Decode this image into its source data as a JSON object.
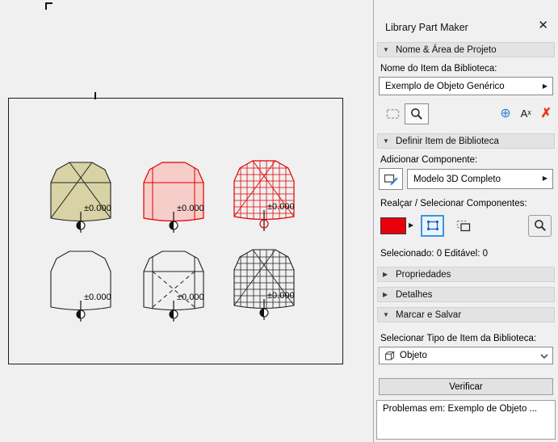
{
  "panel": {
    "title": "Library Part Maker",
    "sections": [
      {
        "label": "Nome & Área de Projeto",
        "arrow": "▼"
      },
      {
        "label": "Definir Item de Biblioteca",
        "arrow": "▼"
      },
      {
        "label": "Propriedades",
        "arrow": "▶"
      },
      {
        "label": "Detalhes",
        "arrow": "▶"
      },
      {
        "label": "Marcar e Salvar",
        "arrow": "▼"
      }
    ],
    "nome_item_label": "Nome do Item da Biblioteca:",
    "nome_item_value": "Exemplo de Objeto Genérico",
    "adicionar_label": "Adicionar Componente:",
    "componente_value": "Modelo 3D Completo",
    "realcar_label": "Realçar / Selecionar Componentes:",
    "selecionado_status": "Selecionado: 0 Editável: 0",
    "tipo_label": "Selecionar Tipo de Item da Biblioteca:",
    "tipo_value": "Objeto",
    "verificar_label": "Verificar",
    "problemas_text": "Problemas em: Exemplo de Objeto ...",
    "colors": {
      "swatch_red": "#e8000d",
      "add_blue": "#2a7fd4",
      "delete_red": "#e8341c",
      "selected_border_blue": "#3a96dd"
    }
  },
  "icons": {
    "close": "✕",
    "flyout_arrow": "▶",
    "add": "⊕",
    "rename": "Aˣ",
    "delete": "✗"
  },
  "canvas": {
    "elevation_label": "±0.000",
    "shape_colors": {
      "symbol_fill_beige": "#d8d3a4",
      "model_fill_pink": "#f7cdc9",
      "highlight_red": "#e00000",
      "wire_black": "#222222"
    }
  }
}
